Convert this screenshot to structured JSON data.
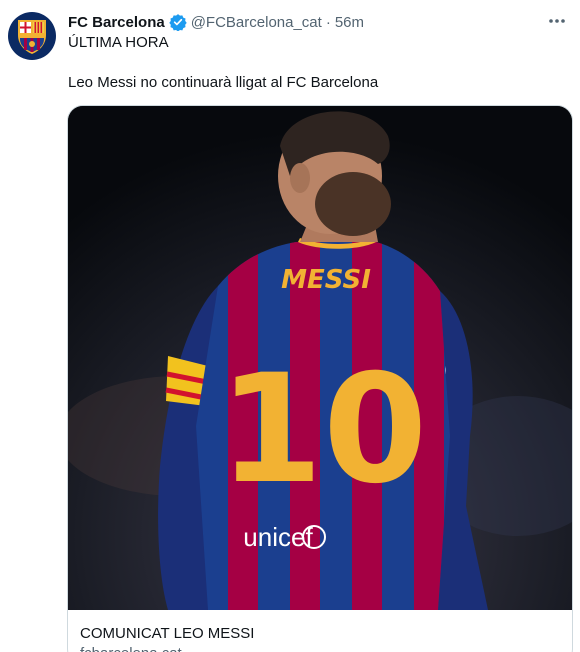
{
  "tweet": {
    "author_name": "FC Barcelona",
    "handle": "@FCBarcelona_cat",
    "separator": "·",
    "time": "56m",
    "text_line1": "ÚLTIMA HORA",
    "text_line2": "Leo Messi no continuarà lligat al FC Barcelona",
    "verified": true
  },
  "card": {
    "title": "COMUNICAT LEO MESSI",
    "subtitle": "fcbarcelona.cat",
    "image": {
      "shirt_name": "MESSI",
      "shirt_number": "10",
      "sponsor": "unicef"
    }
  },
  "icons": {
    "avatar": "fc-barcelona-crest-icon",
    "verified": "verified-badge-icon",
    "more": "more-options-icon"
  },
  "colors": {
    "verified_blue": "#1d9bf0",
    "text_primary": "#0f1419",
    "text_secondary": "#536471",
    "card_border": "#cfd9de",
    "barca_blue": "#1b3f8f",
    "barca_garnet": "#a50044",
    "gold": "#f2b233"
  }
}
